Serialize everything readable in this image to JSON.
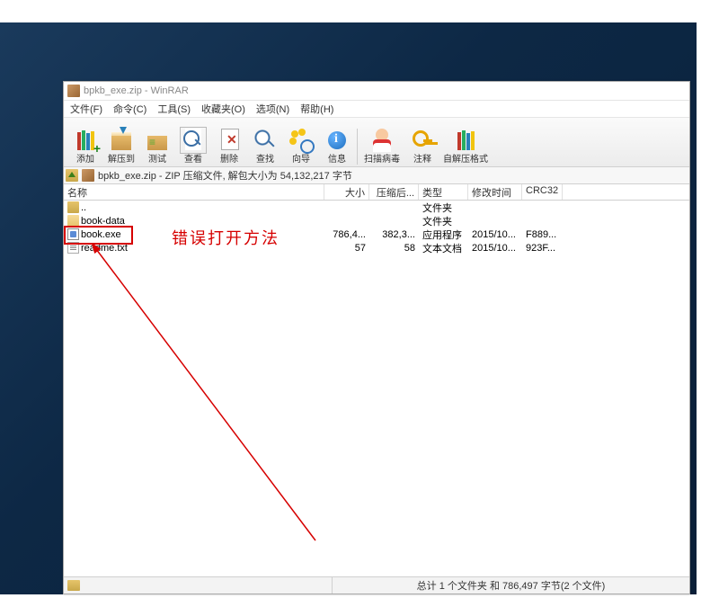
{
  "window": {
    "title": "bpkb_exe.zip - WinRAR"
  },
  "menu": {
    "file": "文件(F)",
    "command": "命令(C)",
    "tool": "工具(S)",
    "favorite": "收藏夹(O)",
    "option": "选项(N)",
    "help": "帮助(H)"
  },
  "toolbar": {
    "add": "添加",
    "extract": "解压到",
    "test": "测试",
    "view": "查看",
    "delete": "删除",
    "find": "查找",
    "wizard": "向导",
    "info": "信息",
    "scan": "扫描病毒",
    "comment": "注释",
    "sfx": "自解压格式"
  },
  "address": {
    "text": "bpkb_exe.zip - ZIP 压缩文件, 解包大小为 54,132,217 字节"
  },
  "columns": {
    "name": "名称",
    "size": "大小",
    "compressed": "压缩后...",
    "type": "类型",
    "date": "修改时间",
    "crc": "CRC32"
  },
  "rows": [
    {
      "name": "..",
      "icon": "up",
      "size": "",
      "compressed": "",
      "type": "文件夹",
      "date": "",
      "crc": ""
    },
    {
      "name": "book-data",
      "icon": "folder",
      "size": "",
      "compressed": "",
      "type": "文件夹",
      "date": "",
      "crc": ""
    },
    {
      "name": "book.exe",
      "icon": "exe",
      "size": "786,4...",
      "compressed": "382,3...",
      "type": "应用程序",
      "date": "2015/10...",
      "crc": "F889..."
    },
    {
      "name": "readme.txt",
      "icon": "txt",
      "size": "57",
      "compressed": "58",
      "type": "文本文档",
      "date": "2015/10...",
      "crc": "923F..."
    }
  ],
  "annotation": {
    "caption": "错误打开方法"
  },
  "status": {
    "summary": "总计 1 个文件夹 和 786,497 字节(2 个文件)"
  }
}
